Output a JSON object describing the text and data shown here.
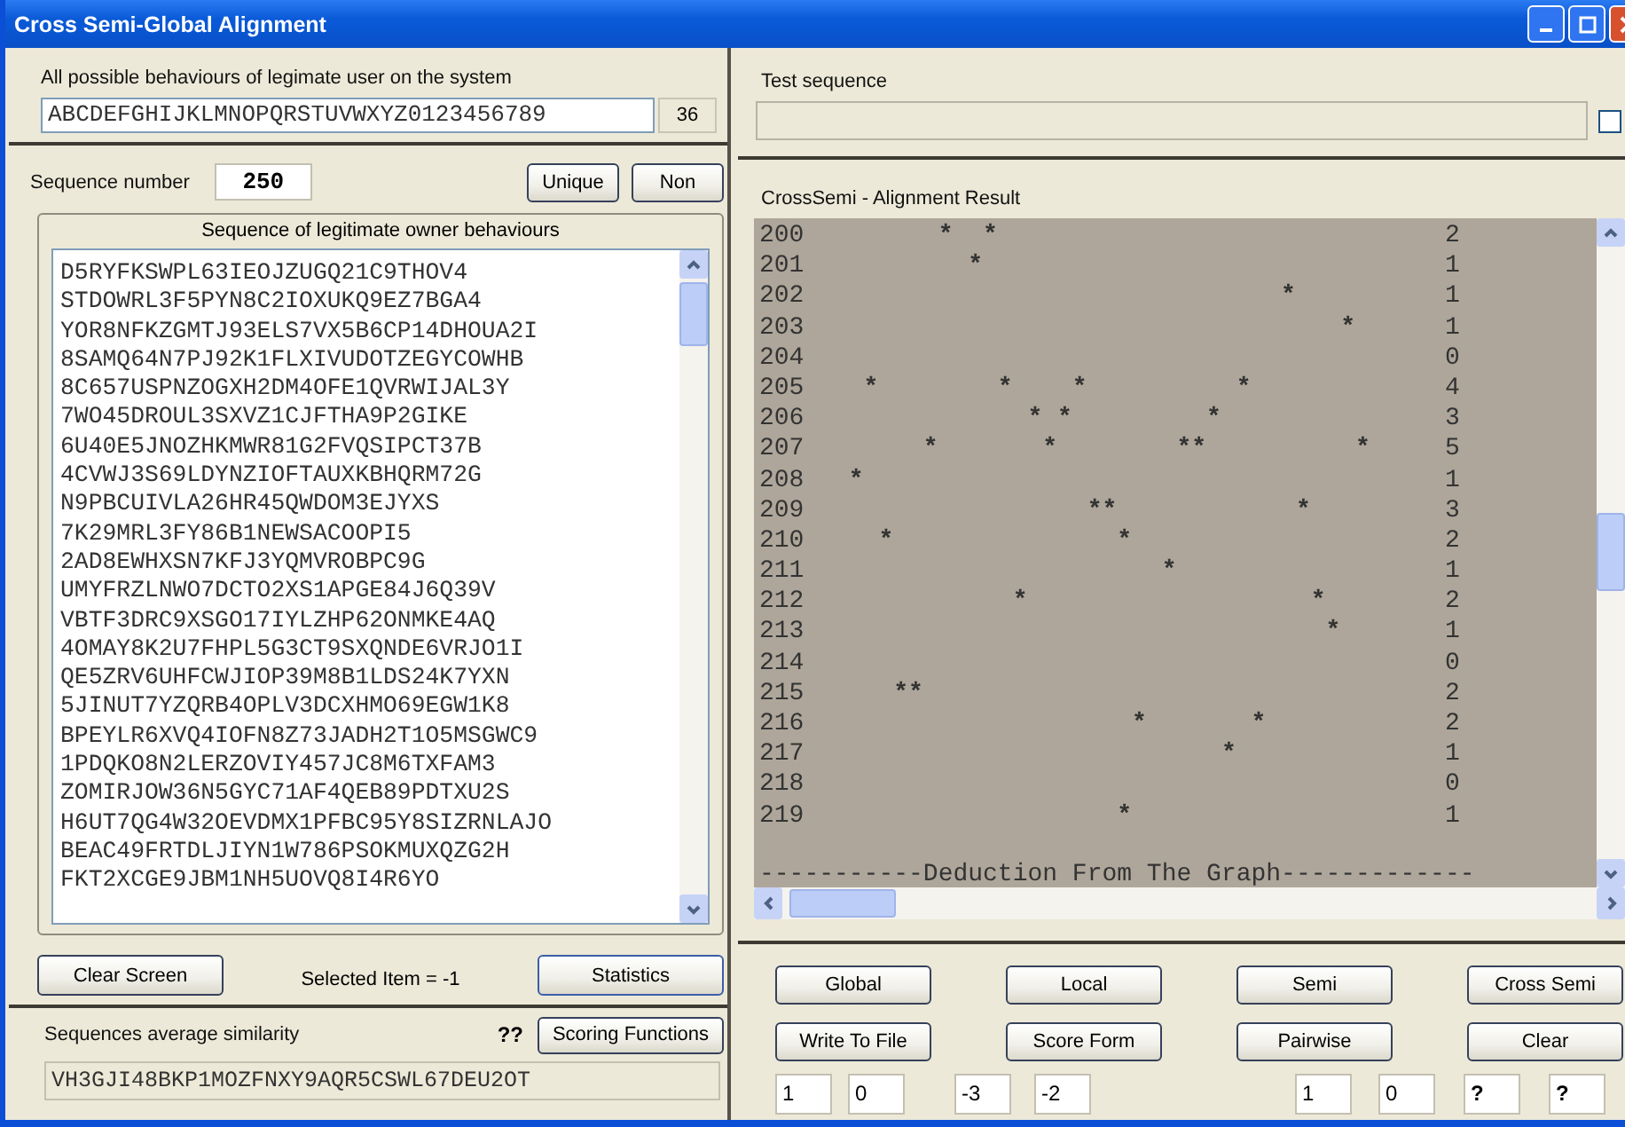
{
  "window": {
    "title": "Cross Semi-Global Alignment"
  },
  "behaviours": {
    "label": "All possible behaviours of legimate user on the system",
    "value": "ABCDEFGHIJKLMNOPQRSTUVWXYZ0123456789",
    "count": "36"
  },
  "sequence_number": {
    "label": "Sequence number",
    "value": "250"
  },
  "top_buttons": [
    "Unique",
    "Non"
  ],
  "owner_sequences": {
    "title": "Sequence of legitimate owner behaviours",
    "items": [
      "D5RYFKSWPL63IEOJZUGQ21C9THOV4",
      "STDOWRL3F5PYN8C2IOXUKQ9EZ7BGA4",
      "YOR8NFKZGMTJ93ELS7VX5B6CP14DHOUA2I",
      "8SAMQ64N7PJ92K1FLXIVUDOTZEGYCOWHB",
      "8C657USPNZOGXH2DM4OFE1QVRWIJAL3Y",
      "7WO45DROUL3SXVZ1CJFTHA9P2GIKE",
      "6U40E5JNOZHKMWR81G2FVQSIPCT37B",
      "4CVWJ3S69LDYNZIOFTAUXKBHQRM72G",
      "N9PBCUIVLA26HR45QWDOM3EJYXS",
      "7K29MRL3FY86B1NEWSACOOPI5",
      "2AD8EWHXSN7KFJ3YQMVROBPC9G",
      "UMYFRZLNWO7DCTO2XS1APGE84J6Q39V",
      "VBTF3DRC9XSGO17IYLZHP62ONMKE4AQ",
      "4OMAY8K2U7FHPL5G3CT9SXQNDE6VRJO1I",
      "QE5ZRV6UHFCWJIOP39M8B1LDS24K7YXN",
      "5JINUT7YZQRB4OPLV3DCXHMO69EGW1K8",
      "BPEYLR6XVQ4IOFN8Z73JADH2T1O5MSGWC9",
      "1PDQKO8N2LERZOVIY457JC8M6TXFAM3",
      "ZOMIRJOW36N5GYC71AF4QEB89PDTXU2S",
      "H6UT7QG4W32OEVDMX1PFBC95Y8SIZRNLAJO",
      "BEAC49FRTDLJIYN1W786PSOKMUXQZG2H",
      "FKT2XCGE9JBM1NH5UOVQ8I4R6YO"
    ]
  },
  "left_buttons": [
    "Clear Screen",
    "Statistics"
  ],
  "selected_item": "Selected Item = -1",
  "similarity": {
    "label": "Sequences average similarity",
    "value": "??",
    "button": "Scoring Functions",
    "sequence": "VH3GJI48BKP1MOZFNXY9AQR5CSWL67DEU2OT"
  },
  "test_sequence": {
    "label": "Test sequence",
    "checked": false
  },
  "result": {
    "title": "CrossSemi - Alignment Result",
    "rows": [
      {
        "number": "200",
        "marks": "         *  *",
        "count": "2"
      },
      {
        "number": "201",
        "marks": "           *",
        "count": "1"
      },
      {
        "number": "202",
        "marks": "                                *",
        "count": "1"
      },
      {
        "number": "203",
        "marks": "                                    *",
        "count": "1"
      },
      {
        "number": "204",
        "count": "0"
      },
      {
        "number": "205",
        "marks": "    *        *    *          *",
        "count": "4"
      },
      {
        "number": "206",
        "marks": "               * *         *",
        "count": "3"
      },
      {
        "number": "207",
        "marks": "        *       *        **          *",
        "count": "5"
      },
      {
        "number": "208",
        "marks": "   *",
        "count": "1"
      },
      {
        "number": "209",
        "marks": "                   **            *",
        "count": "3"
      },
      {
        "number": "210",
        "marks": "     *               *",
        "count": "2"
      },
      {
        "number": "211",
        "marks": "                        *",
        "count": "1"
      },
      {
        "number": "212",
        "marks": "              *                   *",
        "count": "2"
      },
      {
        "number": "213",
        "marks": "                                   *",
        "count": "1"
      },
      {
        "number": "214",
        "count": "0"
      },
      {
        "number": "215",
        "marks": "      **",
        "count": "2"
      },
      {
        "number": "216",
        "marks": "                      *       *",
        "count": "2"
      },
      {
        "number": "217",
        "marks": "                            *",
        "count": "1"
      },
      {
        "number": "218",
        "count": "0"
      },
      {
        "number": "219",
        "marks": "                     *",
        "count": "1"
      }
    ],
    "footer": "-----------Deduction From The Graph-------------"
  },
  "algorithm_buttons": [
    "Global",
    "Local",
    "Semi",
    "Cross Semi",
    "Write To File",
    "Score Form",
    "Pairwise",
    "Clear"
  ],
  "score_fields": [
    "1",
    "0",
    "-3",
    "-2",
    "1",
    "0",
    "?",
    "?"
  ]
}
